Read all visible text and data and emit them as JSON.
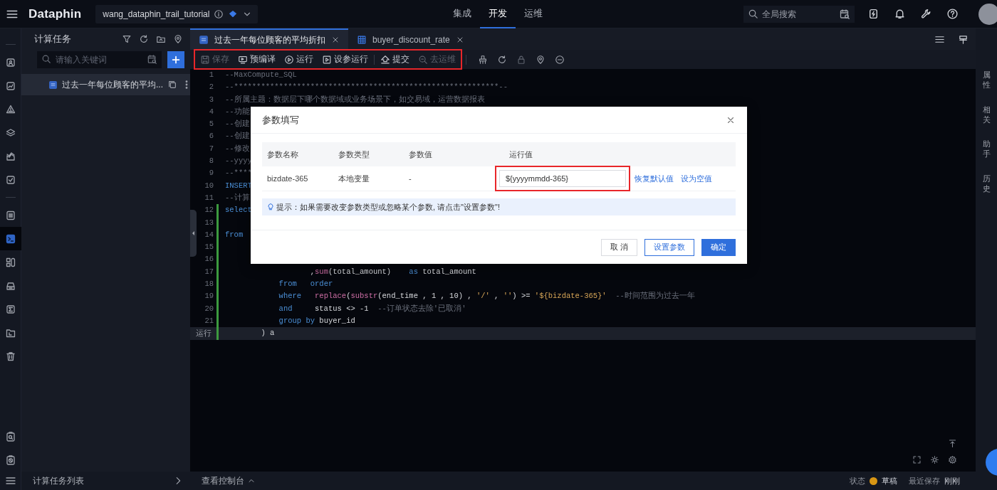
{
  "topbar": {
    "logo": "Dataphin",
    "project": "wang_dataphin_trail_tutorial",
    "nav": [
      {
        "label": "集成",
        "selected": false
      },
      {
        "label": "开发",
        "selected": true
      },
      {
        "label": "运维",
        "selected": false
      }
    ],
    "search": {
      "placeholder": "全局搜索"
    }
  },
  "icon_rail": {
    "top_items": [
      {
        "selected": false
      },
      {
        "selected": false
      },
      {
        "selected": false
      },
      {
        "selected": false
      },
      {
        "selected": false
      },
      {
        "selected": false
      }
    ],
    "middle_items": [
      {
        "selected": false
      },
      {
        "selected": true
      },
      {
        "selected": false
      },
      {
        "selected": false
      },
      {
        "selected": false
      },
      {
        "selected": false
      },
      {
        "selected": false
      }
    ],
    "bottom_items": [
      {
        "selected": false
      },
      {
        "selected": false
      }
    ]
  },
  "task_panel": {
    "title": "计算任务",
    "search": {
      "placeholder": "请输入关键词"
    },
    "tree": [
      {
        "label": "过去一年每位顾客的平均...",
        "selected": true
      }
    ],
    "footer": "计算任务列表"
  },
  "editor_tabs": [
    {
      "label": "过去一年每位顾客的平均折扣",
      "selected": true,
      "kind": "sql"
    },
    {
      "label": "buyer_discount_rate",
      "selected": false,
      "kind": "table"
    }
  ],
  "toolbar": {
    "highlighted": true,
    "buttons": [
      {
        "label": "保存",
        "disabled": true
      },
      {
        "label": "预编译",
        "disabled": false
      },
      {
        "label": "运行",
        "disabled": false
      },
      {
        "label": "设参运行",
        "disabled": false
      },
      {
        "label": "提交",
        "disabled": false
      },
      {
        "label": "去运维",
        "disabled": true
      }
    ]
  },
  "code": {
    "lines": [
      {
        "gutter": "1",
        "changed": false,
        "current": false,
        "tokens": [
          {
            "kind": "comment",
            "text": "--MaxCompute_SQL"
          }
        ]
      },
      {
        "gutter": "2",
        "changed": false,
        "current": false,
        "tokens": [
          {
            "kind": "comment",
            "text": "--***********************************************************--"
          }
        ]
      },
      {
        "gutter": "3",
        "changed": false,
        "current": false,
        "tokens": [
          {
            "kind": "comment",
            "text": "--所属主题：数据层下哪个数据域或业务场景下，如交易域，运营数据报表"
          }
        ]
      },
      {
        "gutter": "4",
        "changed": false,
        "current": false,
        "tokens": [
          {
            "kind": "comment",
            "text": "--功能"
          }
        ]
      },
      {
        "gutter": "5",
        "changed": false,
        "current": false,
        "tokens": [
          {
            "kind": "comment",
            "text": "--创建"
          }
        ]
      },
      {
        "gutter": "6",
        "changed": false,
        "current": false,
        "tokens": [
          {
            "kind": "comment",
            "text": "--创建"
          }
        ]
      },
      {
        "gutter": "7",
        "changed": false,
        "current": false,
        "tokens": [
          {
            "kind": "comment",
            "text": "--修改"
          }
        ]
      },
      {
        "gutter": "8",
        "changed": false,
        "current": false,
        "tokens": [
          {
            "kind": "comment",
            "text": "--yyyy"
          }
        ]
      },
      {
        "gutter": "9",
        "changed": false,
        "current": false,
        "tokens": [
          {
            "kind": "comment",
            "text": "--****"
          }
        ]
      },
      {
        "gutter": "10",
        "changed": false,
        "current": false,
        "tokens": [
          {
            "kind": "keyword",
            "text": "INSERT"
          }
        ]
      },
      {
        "gutter": "11",
        "changed": false,
        "current": false,
        "tokens": [
          {
            "kind": "comment",
            "text": "--计算"
          }
        ]
      },
      {
        "gutter": "12",
        "changed": true,
        "current": false,
        "tokens": [
          {
            "kind": "keyword",
            "text": "select"
          }
        ]
      },
      {
        "gutter": "13",
        "changed": true,
        "current": false
      },
      {
        "gutter": "14",
        "changed": true,
        "current": false,
        "tokens": [
          {
            "kind": "keyword",
            "text": "from"
          }
        ]
      },
      {
        "gutter": "15",
        "changed": true,
        "current": false
      },
      {
        "gutter": "16",
        "changed": true,
        "current": false
      },
      {
        "gutter": "17",
        "changed": true,
        "current": false,
        "tokens": [
          {
            "kind": "plain",
            "text": "                   ,"
          },
          {
            "kind": "function",
            "text": "sum"
          },
          {
            "kind": "plain",
            "text": "(total_amount)    "
          },
          {
            "kind": "keyword",
            "text": "as"
          },
          {
            "kind": "plain",
            "text": " total_amount"
          }
        ]
      },
      {
        "gutter": "18",
        "changed": true,
        "current": false,
        "tokens": [
          {
            "kind": "keyword",
            "text": "            from   "
          },
          {
            "kind": "keyword",
            "text": "order"
          }
        ]
      },
      {
        "gutter": "19",
        "changed": true,
        "current": false,
        "tokens": [
          {
            "kind": "keyword",
            "text": "            where   "
          },
          {
            "kind": "function",
            "text": "replace"
          },
          {
            "kind": "plain",
            "text": "("
          },
          {
            "kind": "function",
            "text": "substr"
          },
          {
            "kind": "plain",
            "text": "(end_time , 1 , 10) , "
          },
          {
            "kind": "string",
            "text": "'/'"
          },
          {
            "kind": "plain",
            "text": " , "
          },
          {
            "kind": "string",
            "text": "''"
          },
          {
            "kind": "plain",
            "text": ") >= "
          },
          {
            "kind": "string",
            "text": "'${bizdate-365}'"
          },
          {
            "kind": "comment",
            "text": "  --时间范围为过去一年"
          }
        ]
      },
      {
        "gutter": "20",
        "changed": true,
        "current": false,
        "tokens": [
          {
            "kind": "keyword",
            "text": "            and"
          },
          {
            "kind": "plain",
            "text": "     status <> -1"
          },
          {
            "kind": "comment",
            "text": "  --订单状态去除'已取消'"
          }
        ]
      },
      {
        "gutter": "21",
        "changed": true,
        "current": false,
        "tokens": [
          {
            "kind": "keyword",
            "text": "            group by"
          },
          {
            "kind": "plain",
            "text": " buyer_id"
          }
        ]
      },
      {
        "gutter": "运行",
        "changed": true,
        "current": true,
        "tokens": [
          {
            "kind": "plain",
            "text": "        ) a"
          }
        ]
      }
    ]
  },
  "modal": {
    "title": "参数填写",
    "columns": [
      "参数名称",
      "参数类型",
      "参数值",
      "运行值"
    ],
    "rows": [
      {
        "name": "bizdate-365",
        "type": "本地变量",
        "value": "-",
        "run_value": "${yyyymmdd-365}",
        "highlighted": true,
        "actions": [
          "恢复默认值",
          "设为空值"
        ]
      }
    ],
    "hint": "提示：如果需要改变参数类型或忽略某个参数, 请点击\"设置参数\"!",
    "buttons": [
      {
        "label": "取 消",
        "kind": "default"
      },
      {
        "label": "设置参数",
        "kind": "outline"
      },
      {
        "label": "确定",
        "kind": "primary"
      }
    ]
  },
  "right_rail": [
    "属性",
    "相关",
    "助手",
    "历史"
  ],
  "status_bar": {
    "console": "查看控制台",
    "state_label": "状态",
    "state": "草稿",
    "saved_label": "最近保存",
    "saved": "刚刚"
  }
}
